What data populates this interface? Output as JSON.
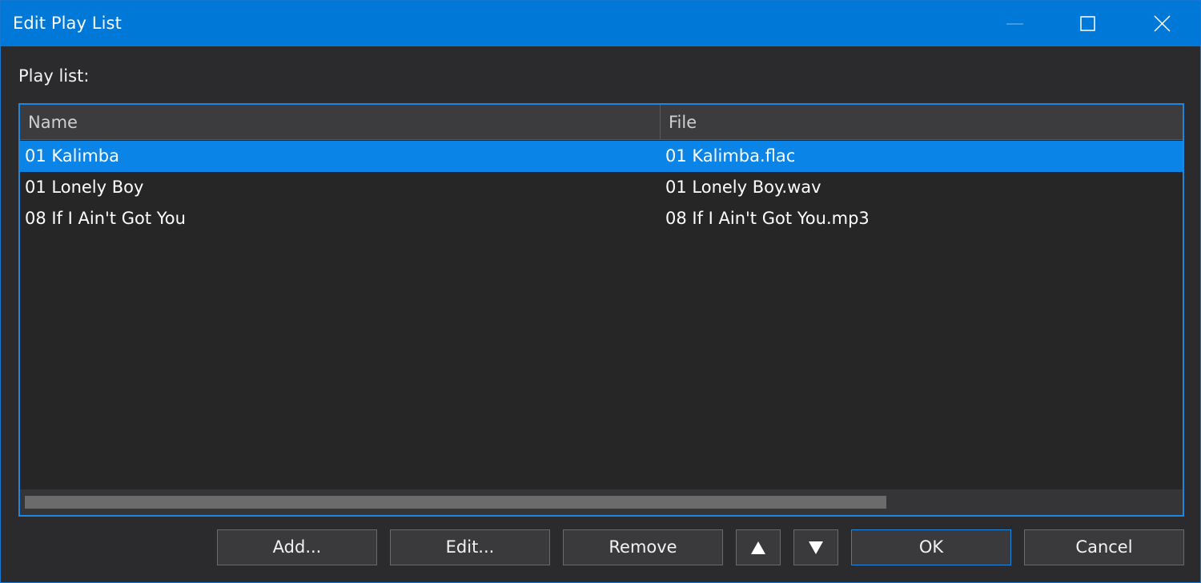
{
  "window": {
    "title": "Edit Play List"
  },
  "playlist_label": "Play list:",
  "listview": {
    "columns": [
      "Name",
      "File"
    ],
    "rows": [
      {
        "name": "01 Kalimba",
        "file": "01 Kalimba.flac",
        "selected": true
      },
      {
        "name": "01 Lonely Boy",
        "file": "01 Lonely Boy.wav",
        "selected": false
      },
      {
        "name": "08 If I Ain't Got You",
        "file": "08 If I Ain't Got You.mp3",
        "selected": false
      }
    ]
  },
  "buttons": {
    "add": "Add...",
    "edit": "Edit...",
    "remove": "Remove",
    "move_up_icon": "triangle-up-icon",
    "move_down_icon": "triangle-down-icon",
    "ok": "OK",
    "cancel": "Cancel"
  },
  "colors": {
    "titlebar": "#0078d7",
    "selection": "#0a84e6",
    "background": "#2b2b2d",
    "focus_border": "#1e86dc"
  }
}
